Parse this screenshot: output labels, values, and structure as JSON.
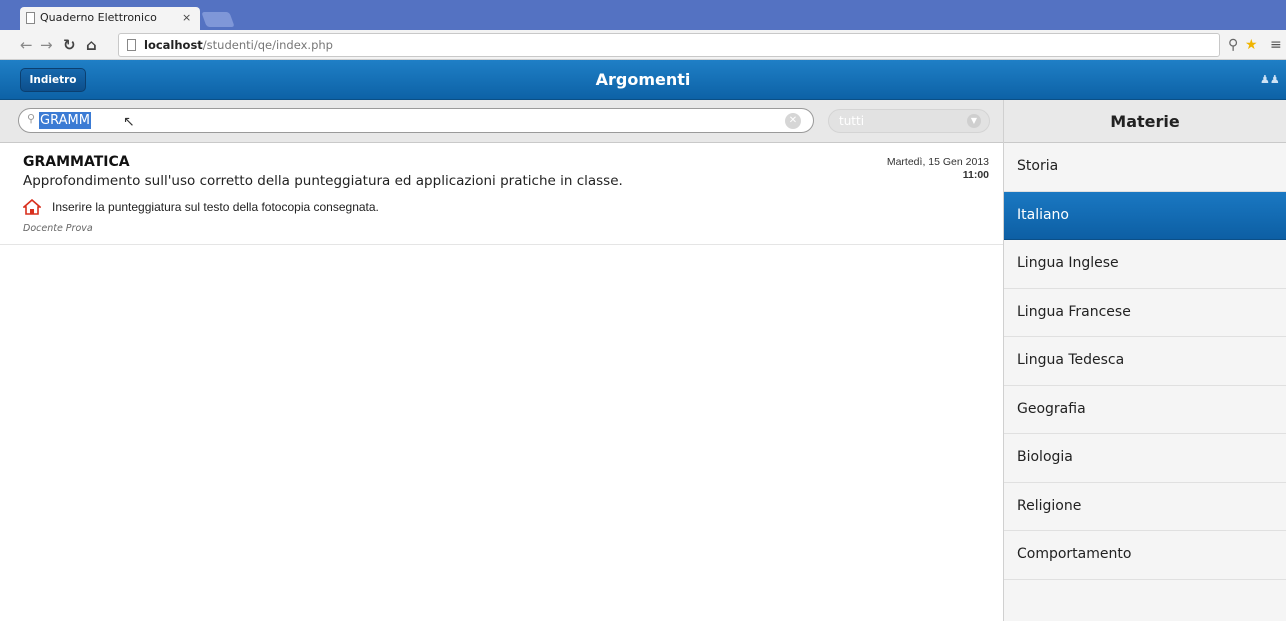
{
  "browser": {
    "tab_title": "Quaderno Elettronico",
    "tab_close": "×",
    "url_host": "localhost",
    "url_path": "/studenti/qe/index.php"
  },
  "header": {
    "back_label": "Indietro",
    "title": "Argomenti"
  },
  "search": {
    "value": "GRAMM",
    "filter_value": "tutti"
  },
  "entries": [
    {
      "title": "GRAMMATICA",
      "description": "Approfondimento sull'uso corretto della punteggiatura ed applicazioni pratiche in classe.",
      "homework": "Inserire la punteggiatura sul testo della fotocopia consegnata.",
      "teacher": "Docente Prova",
      "date": "Martedì, 15 Gen 2013",
      "time": "11:00"
    }
  ],
  "subjects": {
    "title": "Materie",
    "items": [
      {
        "label": "Storia"
      },
      {
        "label": "Italiano"
      },
      {
        "label": "Lingua Inglese"
      },
      {
        "label": "Lingua Francese"
      },
      {
        "label": "Lingua Tedesca"
      },
      {
        "label": "Geografia"
      },
      {
        "label": "Biologia"
      },
      {
        "label": "Religione"
      },
      {
        "label": "Comportamento"
      }
    ],
    "selected": "Italiano"
  },
  "colors": {
    "chrome_blue": "#5472c2",
    "header_blue": "#1f7fc6",
    "active_item_blue": "#1a78c2",
    "home_icon_red": "#d9301e"
  }
}
